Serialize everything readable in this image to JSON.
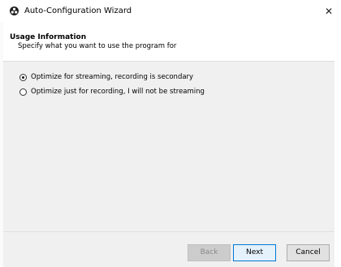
{
  "window": {
    "title": "Auto-Configuration Wizard",
    "close_glyph": "✕"
  },
  "header": {
    "title": "Usage Information",
    "subtitle": "Specify what you want to use the program for"
  },
  "options": [
    {
      "label": "Optimize for streaming, recording is secondary",
      "checked": true
    },
    {
      "label": "Optimize just for recording, I will not be streaming",
      "checked": false
    }
  ],
  "buttons": {
    "back": "Back",
    "next": "Next",
    "cancel": "Cancel"
  }
}
